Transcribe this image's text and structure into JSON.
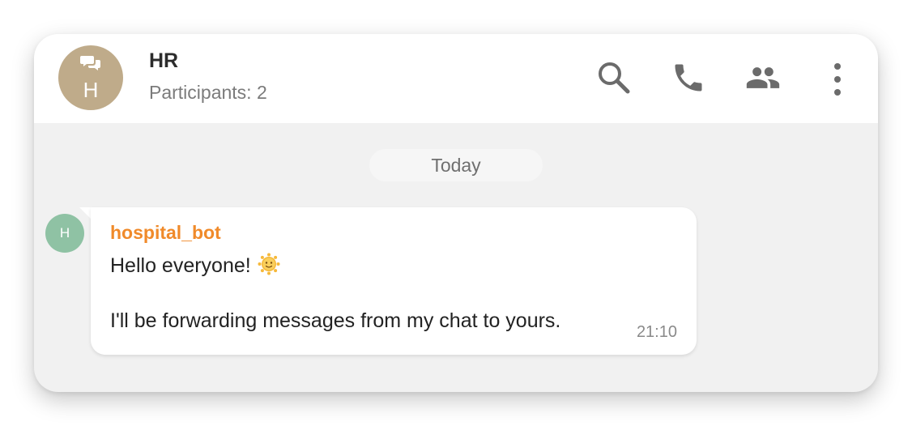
{
  "header": {
    "avatar_initial": "H",
    "avatar_icon": "chat-bubbles-icon",
    "title": "HR",
    "subtitle": "Participants: 2",
    "actions": [
      {
        "name": "search",
        "icon": "search-icon"
      },
      {
        "name": "call",
        "icon": "phone-icon"
      },
      {
        "name": "participants",
        "icon": "people-icon"
      },
      {
        "name": "more",
        "icon": "more-vertical-icon"
      }
    ]
  },
  "conversation": {
    "date_separator": "Today",
    "messages": [
      {
        "sender": "hospital_bot",
        "avatar_initial": "H",
        "line1": "Hello everyone!",
        "emoji": "sun-with-face",
        "line2": "I'll be forwarding messages from my chat to yours.",
        "time": "21:10"
      }
    ]
  },
  "colors": {
    "chat_avatar": "#bfab8a",
    "sender_avatar": "#8fc2a4",
    "sender_name": "#f08a2a",
    "background": "#f1f1f1",
    "icon": "#6b6b6b"
  }
}
